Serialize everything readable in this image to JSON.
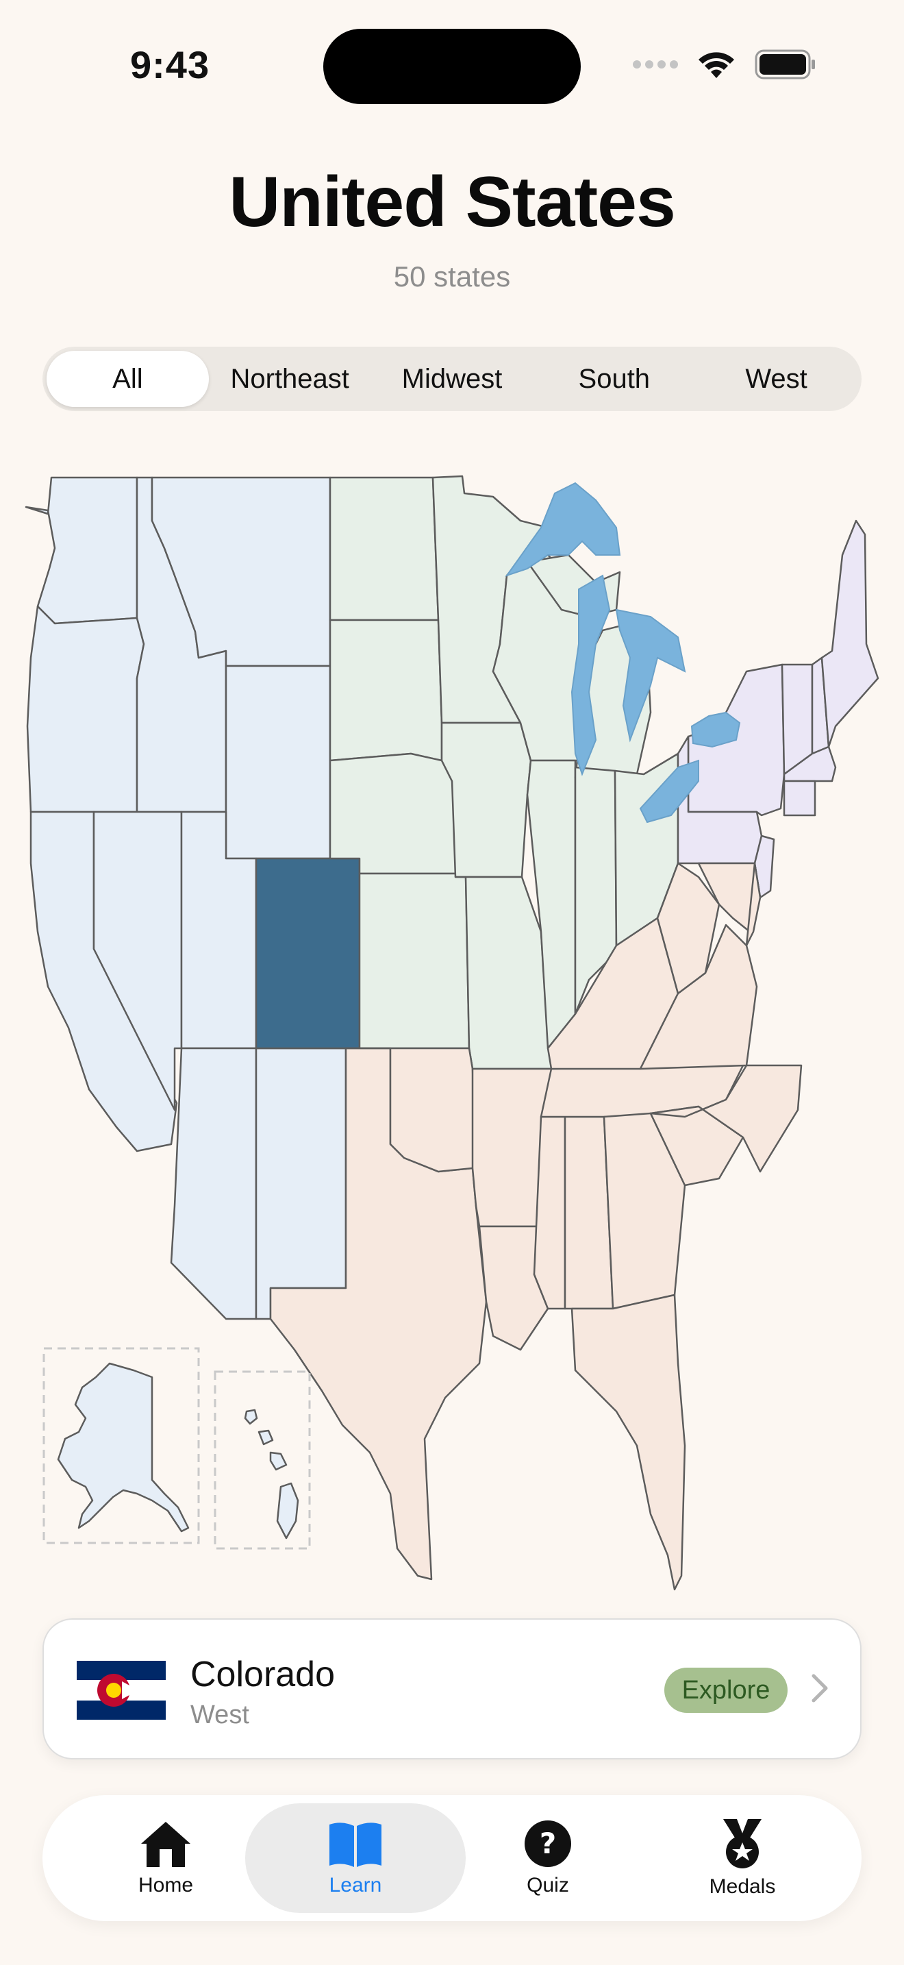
{
  "status_bar": {
    "time": "9:43"
  },
  "header": {
    "title": "United States",
    "subtitle": "50 states"
  },
  "region_filter": {
    "selected": "All",
    "options": [
      "All",
      "Northeast",
      "Midwest",
      "South",
      "West"
    ]
  },
  "map": {
    "selected_state": "Colorado",
    "colors": {
      "west": "#e6eef7",
      "midwest": "#e7f0e8",
      "south": "#f7e8df",
      "northeast": "#ebe7f6",
      "selected": "#3d6c8d",
      "lakes": "#7ab3dc"
    }
  },
  "state_card": {
    "name": "Colorado",
    "region": "West",
    "explore_label": "Explore",
    "flag_icon": "colorado-flag-icon",
    "accent": "#a6c08f"
  },
  "tab_bar": {
    "active": "Learn",
    "tabs": [
      {
        "label": "Home",
        "icon": "house-icon"
      },
      {
        "label": "Learn",
        "icon": "book-icon"
      },
      {
        "label": "Quiz",
        "icon": "question-circle-icon"
      },
      {
        "label": "Medals",
        "icon": "medal-icon"
      }
    ],
    "active_color": "#1c7ff0"
  }
}
